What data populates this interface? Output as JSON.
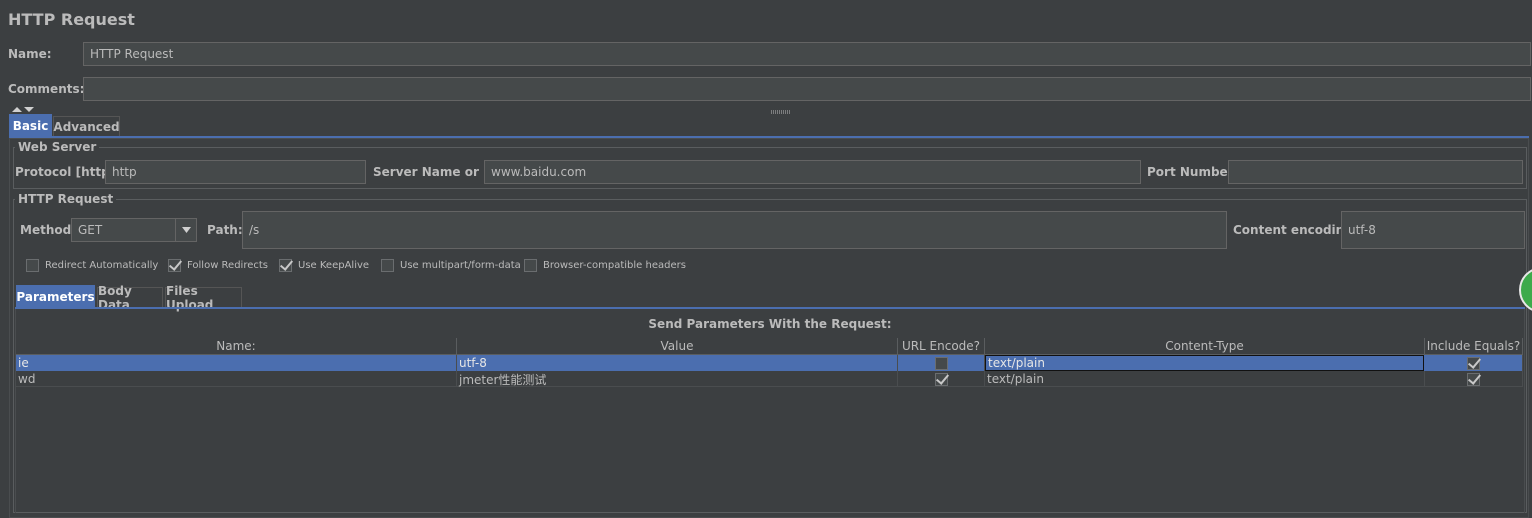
{
  "header": {
    "title": "HTTP Request"
  },
  "name_field": {
    "label": "Name:",
    "value": "HTTP Request"
  },
  "comments_field": {
    "label": "Comments:",
    "value": ""
  },
  "top_tabs": [
    {
      "label": "Basic",
      "selected": true
    },
    {
      "label": "Advanced",
      "selected": false
    }
  ],
  "web_server": {
    "title": "Web Server",
    "protocol_label": "Protocol [http]:",
    "protocol_value": "http",
    "server_label": "Server Name or IP:",
    "server_value": "www.baidu.com",
    "port_label": "Port Number:",
    "port_value": ""
  },
  "http_request": {
    "title": "HTTP Request",
    "method_label": "Method:",
    "method_value": "GET",
    "path_label": "Path:",
    "path_value": "/s",
    "encoding_label": "Content encoding:",
    "encoding_value": "utf-8",
    "options": [
      {
        "label": "Redirect Automatically",
        "checked": false
      },
      {
        "label": "Follow Redirects",
        "checked": true
      },
      {
        "label": "Use KeepAlive",
        "checked": true
      },
      {
        "label": "Use multipart/form-data",
        "checked": false
      },
      {
        "label": "Browser-compatible headers",
        "checked": false
      }
    ]
  },
  "param_tabs": [
    {
      "label": "Parameters",
      "selected": true
    },
    {
      "label": "Body Data",
      "selected": false
    },
    {
      "label": "Files Upload",
      "selected": false
    }
  ],
  "params_table": {
    "caption": "Send Parameters With the Request:",
    "columns": [
      "Name:",
      "Value",
      "URL Encode?",
      "Content-Type",
      "Include Equals?"
    ],
    "rows": [
      {
        "name": "ie",
        "value": "utf-8",
        "url_encode": false,
        "content_type": "text/plain",
        "include_equals": true,
        "selected": true
      },
      {
        "name": "wd",
        "value": "jmeter性能测试",
        "url_encode": true,
        "content_type": "text/plain",
        "include_equals": true,
        "selected": false
      }
    ]
  },
  "colors": {
    "background": "#3c3f41",
    "selection": "#4b6eaf",
    "field": "#45494a",
    "badge": "#3daa4b"
  }
}
